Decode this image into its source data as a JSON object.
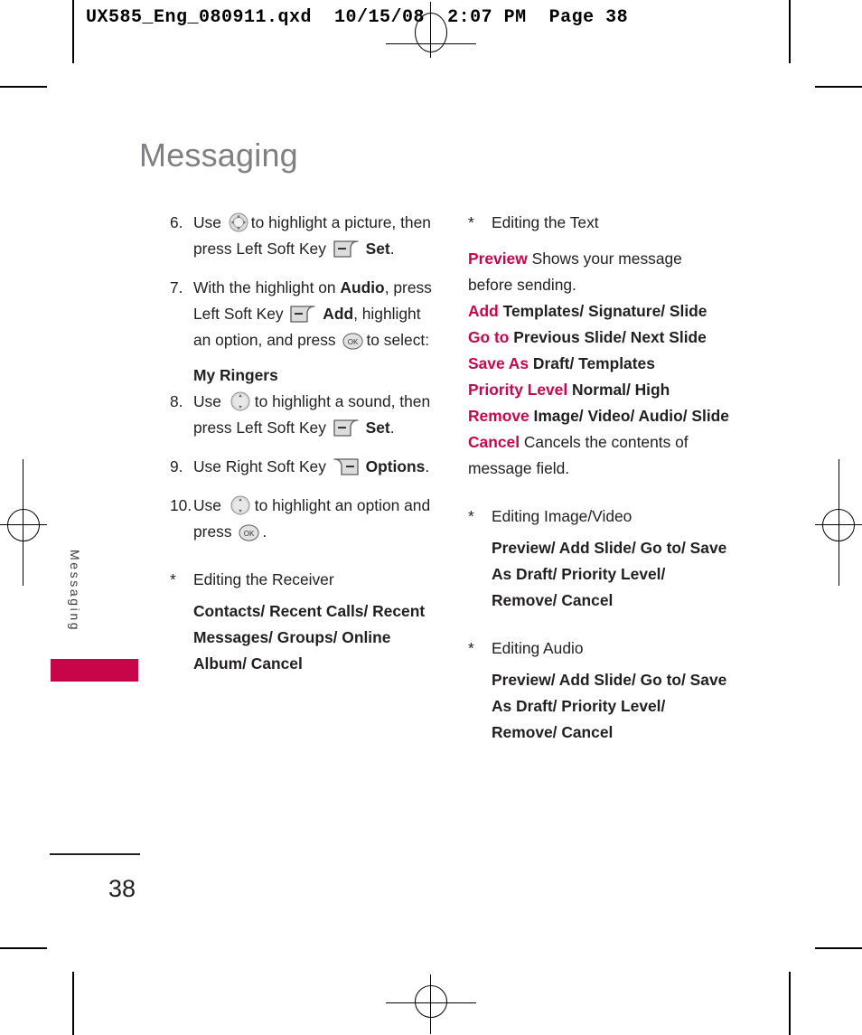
{
  "prepress": {
    "header_line": "UX585_Eng_080911.qxd  10/15/08  2:07 PM  Page 38"
  },
  "chapter": {
    "title": "Messaging",
    "side_tab_label": "Messaging",
    "accent_color": "#c8054a",
    "title_color": "#807f83"
  },
  "footer": {
    "page_number": "38"
  },
  "left_column": {
    "steps": [
      {
        "num": "6.",
        "part1": "Use",
        "icon1": "nav-4way-icon",
        "part2": "to highlight a picture, then press Left Soft Key",
        "icon2": "left-soft-key-icon",
        "bold_tail": "Set",
        "part3": "."
      },
      {
        "num": "7.",
        "part1": "With the highlight on",
        "bold1": "Audio",
        "part2": ", press Left Soft Key",
        "icon2": "left-soft-key-icon",
        "bold2": "Add",
        "part3": ", highlight an option, and press",
        "icon3": "ok-key-icon",
        "part4": "to select:"
      },
      {
        "num": "8.",
        "part1": "Use",
        "icon1": "nav-updown-icon",
        "part2": "to highlight a sound, then press Left Soft Key",
        "icon2": "left-soft-key-icon",
        "bold_tail": "Set",
        "part3": "."
      },
      {
        "num": "9.",
        "part1": "Use Right Soft Key",
        "icon1": "right-soft-key-icon",
        "bold_tail": "Options",
        "part3": "."
      },
      {
        "num": "10.",
        "part1": "Use",
        "icon1": "nav-updown-icon",
        "part2": "to highlight an option and press",
        "icon3": "ok-key-icon",
        "part4": "."
      }
    ],
    "step7_option": "My Ringers",
    "receiver_section": {
      "star": "*",
      "heading": "Editing the Receiver",
      "options": "Contacts/ Recent Calls/ Recent Messages/ Groups/ Online Album/ Cancel"
    }
  },
  "right_column": {
    "editing_text": {
      "star": "*",
      "heading": "Editing the Text",
      "entries": [
        {
          "keyword": "Preview",
          "desc": "Shows your message before sending.",
          "desc_bold": false
        },
        {
          "keyword": "Add",
          "desc": "Templates/ Signature/ Slide",
          "desc_bold": true
        },
        {
          "keyword": "Go to",
          "desc": "Previous Slide/ Next Slide",
          "desc_bold": true
        },
        {
          "keyword": "Save As",
          "desc": "Draft/ Templates",
          "desc_bold": true
        },
        {
          "keyword": "Priority Level",
          "desc": "Normal/ High",
          "desc_bold": true
        },
        {
          "keyword": "Remove",
          "desc": "Image/ Video/ Audio/ Slide",
          "desc_bold": true
        },
        {
          "keyword": "Cancel",
          "desc": "Cancels the contents of message field.",
          "desc_bold": false
        }
      ]
    },
    "editing_image_video": {
      "star": "*",
      "heading": "Editing Image/Video",
      "options": "Preview/ Add Slide/ Go to/ Save As Draft/ Priority Level/ Remove/ Cancel"
    },
    "editing_audio": {
      "star": "*",
      "heading": "Editing Audio",
      "options": "Preview/ Add Slide/ Go to/ Save As Draft/ Priority Level/ Remove/ Cancel"
    }
  }
}
